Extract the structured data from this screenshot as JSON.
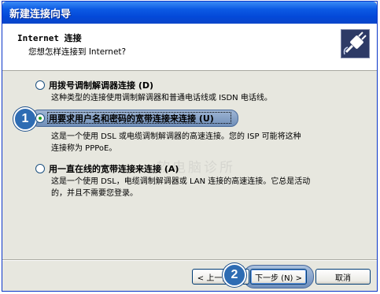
{
  "window": {
    "title": "新建连接向导"
  },
  "header": {
    "title": "Internet 连接",
    "subtitle": "您想怎样连接到 Internet?"
  },
  "options": [
    {
      "label": "用拨号调制解调器连接 (D)",
      "description_lines": [
        "这种类型的连接使用调制解调器和普通电话线或 ISDN 电话线。"
      ],
      "selected": false
    },
    {
      "label": "用要求用户名和密码的宽带连接来连接 (U)",
      "description_lines": [
        "这是一个使用 DSL 或电缆调制解调器的高速连接。您的 ISP 可能将这种",
        "连接称为 PPPoE。"
      ],
      "selected": true
    },
    {
      "label": "用一直在线的宽带连接来连接 (A)",
      "description_lines": [
        "这是一个使用 DSL，电缆调制解调器或 LAN 连接的高速连接。它总是活动",
        "的，并且不需要您登录。"
      ],
      "selected": false
    }
  ],
  "annotations": {
    "badge1": "1",
    "badge2": "2"
  },
  "watermark": "软电脑诊所",
  "buttons": {
    "back": "< 上一步 (B)",
    "next": "下一步 (N) >",
    "cancel": "取消"
  },
  "colors": {
    "titlebar": "#0a46c9",
    "highlight": "#6f8eb8",
    "radio_dot": "#21a121"
  }
}
